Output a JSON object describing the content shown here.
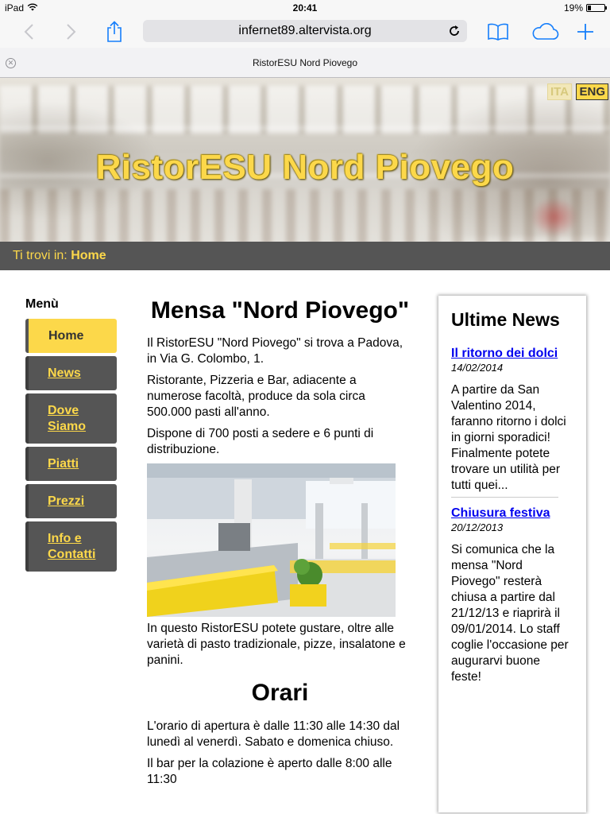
{
  "status_bar": {
    "device": "iPad",
    "time": "20:41",
    "battery": "19%"
  },
  "browser": {
    "url": "infernet89.altervista.org",
    "tab_title": "RistorESU Nord Piovego",
    "icons": [
      "back-icon",
      "forward-icon",
      "share-icon",
      "reload-icon",
      "bookmarks-icon",
      "icloud-tabs-icon",
      "new-tab-icon",
      "close-tab-icon"
    ]
  },
  "header": {
    "site_title": "RistorESU Nord Piovego",
    "lang_ita": "ITA",
    "lang_eng": "ENG"
  },
  "breadcrumb": {
    "prefix": "Ti trovi in:",
    "current": "Home"
  },
  "menu": {
    "title": "Menù",
    "items": [
      {
        "label": "Home",
        "active": true
      },
      {
        "label": "News"
      },
      {
        "label": "Dove Siamo"
      },
      {
        "label": "Piatti"
      },
      {
        "label": "Prezzi"
      },
      {
        "label": "Info e Contatti"
      }
    ]
  },
  "main": {
    "heading": "Mensa \"Nord Piovego\"",
    "paragraphs": [
      "Il RistorESU \"Nord Piovego\" si trova a Padova, in Via G. Colombo, 1.",
      "Ristorante, Pizzeria e Bar, adiacente a numerose facoltà, produce da sola circa 500.000 pasti all'anno.",
      "Dispone di 700 posti a sedere e 6 punti di distribuzione."
    ],
    "caption": "In questo RistorESU potete gustare, oltre alle varietà di pasto tradizionale, pizze, insalatone e panini.",
    "hours_heading": "Orari",
    "hours_paragraphs": [
      "L'orario di apertura è dalle 11:30 alle 14:30 dal lunedì al venerdì. Sabato e domenica chiuso.",
      "Il bar per la colazione è aperto dalle 8:00 alle 11:30"
    ]
  },
  "news": {
    "title": "Ultime News",
    "items": [
      {
        "title": "Il ritorno dei dolci",
        "date": "14/02/2014",
        "text": "A partire da San Valentino 2014, faranno ritorno i dolci in giorni sporadici! Finalmente potete trovare un utilità per tutti quei..."
      },
      {
        "title": "Chiusura festiva",
        "date": "20/12/2013",
        "text": "Si comunica che la mensa \"Nord Piovego\" resterà chiusa a partire dal 21/12/13 e riaprirà il 09/01/2014. Lo staff coglie l'occasione per augurarvi buone feste!"
      }
    ]
  },
  "colors": {
    "accent_yellow": "#fcd84a",
    "menu_gray": "#555555",
    "link_blue": "#0000ee",
    "ios_blue": "#157efb"
  }
}
